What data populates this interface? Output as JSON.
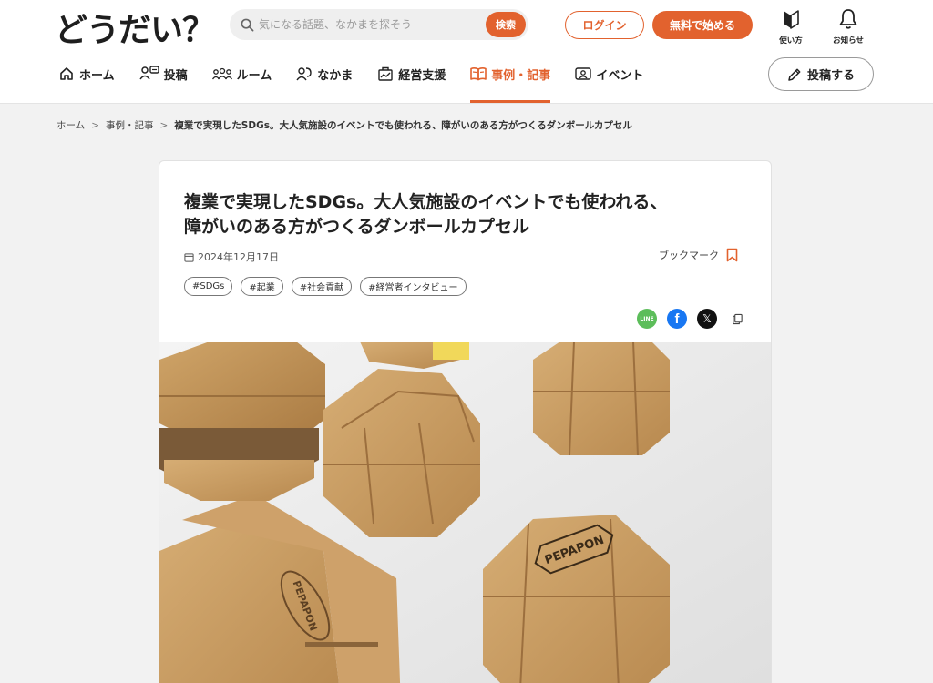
{
  "header": {
    "logo": "どうだい？",
    "search": {
      "placeholder": "気になる話題、なかまを探そう",
      "button": "検索"
    },
    "login": "ログイン",
    "signup": "無料で始める",
    "utilities": [
      {
        "label": "使い方",
        "icon": "beginner-mark-icon"
      },
      {
        "label": "お知らせ",
        "icon": "bell-icon"
      }
    ],
    "nav": [
      {
        "label": "ホーム",
        "icon": "home-icon",
        "active": false
      },
      {
        "label": "投稿",
        "icon": "post-icon",
        "active": false
      },
      {
        "label": "ルーム",
        "icon": "room-icon",
        "active": false
      },
      {
        "label": "なかま",
        "icon": "friends-icon",
        "active": false
      },
      {
        "label": "経営支援",
        "icon": "management-support-icon",
        "active": false
      },
      {
        "label": "事例・記事",
        "icon": "book-icon",
        "active": true
      },
      {
        "label": "イベント",
        "icon": "event-icon",
        "active": false
      }
    ],
    "post_button": "投稿する"
  },
  "breadcrumb": [
    "ホーム",
    "事例・記事",
    "複業で実現したSDGs。大人気施設のイベントでも使われる、障がいのある方がつくるダンボールカプセル"
  ],
  "article": {
    "title_line1": "複業で実現したSDGs。大人気施設のイベントでも使われる、",
    "title_line2": "障がいのある方がつくるダンボールカプセル",
    "date": "2024年12月17日",
    "bookmark": "ブックマーク",
    "tags": [
      "#SDGs",
      "#起業",
      "#社会貢献",
      "#経営者インタビュー"
    ],
    "share": [
      {
        "name": "line",
        "label": "LINE"
      },
      {
        "name": "facebook",
        "label": "f"
      },
      {
        "name": "x",
        "label": "𝕏"
      },
      {
        "name": "copy",
        "label": ""
      }
    ],
    "hero_image_text": [
      "PEPAPON",
      "PEPAPON"
    ]
  },
  "colors": {
    "accent": "#e2622e",
    "cardboard": "#c9a06a",
    "line": "#5cbd5a",
    "facebook": "#1877f2"
  }
}
